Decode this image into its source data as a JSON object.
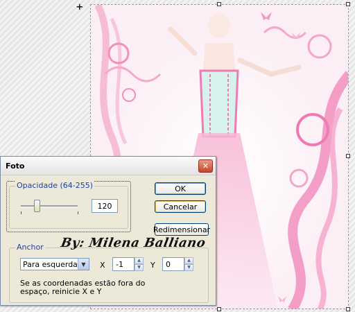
{
  "canvas": {
    "watermark": "By: Milena Balliano",
    "bg_color": "#fdf6f9",
    "accent_pink": "#f07ab4"
  },
  "dialog": {
    "title": "Foto",
    "opacity": {
      "legend": "Opacidade (64-255)",
      "value": "120",
      "slider_fraction": 0.28
    },
    "buttons": {
      "ok": "OK",
      "cancel": "Cancelar",
      "resize": "Redimensionar"
    },
    "anchor": {
      "legend": "Anchor",
      "select_value": "Para esquerda",
      "x_label": "X",
      "x_value": "-1",
      "y_label": "Y",
      "y_value": "0",
      "hint": "Se as coordenadas estão fora do espaço, reinicie X e Y"
    }
  }
}
